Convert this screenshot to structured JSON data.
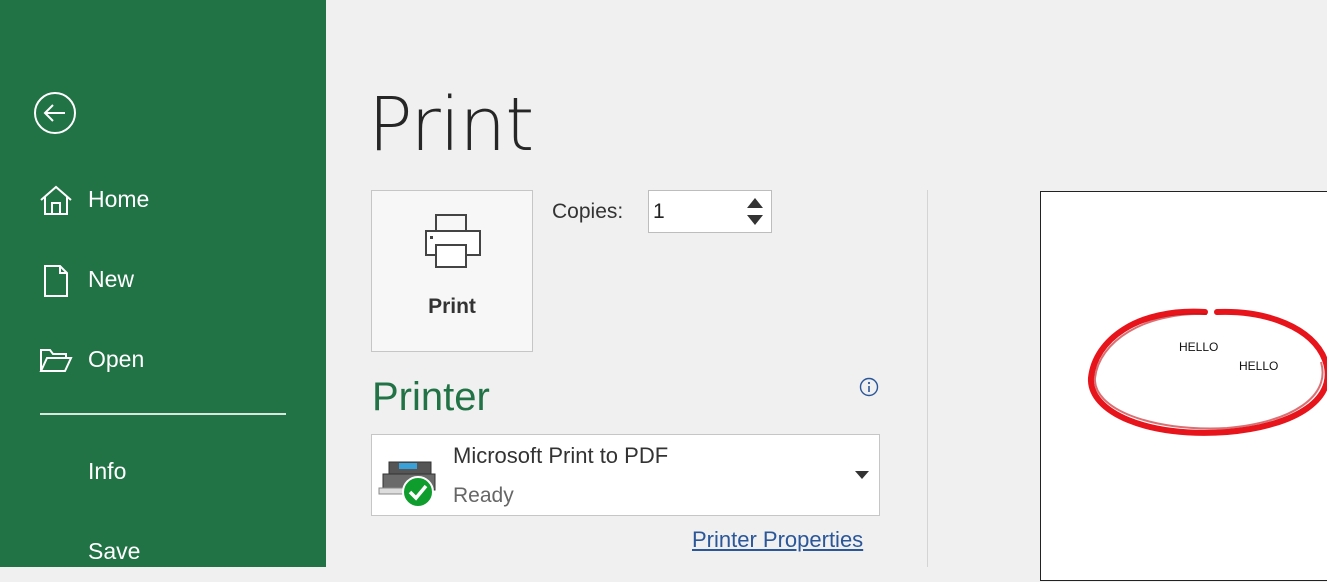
{
  "sidebar": {
    "back_icon": "back-arrow-icon",
    "items": [
      {
        "label": "Home",
        "icon": "home-icon"
      },
      {
        "label": "New",
        "icon": "new-document-icon"
      },
      {
        "label": "Open",
        "icon": "open-folder-icon"
      },
      {
        "label": "Info",
        "icon": ""
      },
      {
        "label": "Save",
        "icon": ""
      }
    ],
    "background": "#217346"
  },
  "main": {
    "title": "Print",
    "print_button_label": "Print",
    "copies_label": "Copies:",
    "copies_value": "1",
    "printer_heading": "Printer",
    "printer": {
      "name": "Microsoft Print to PDF",
      "status": "Ready"
    },
    "printer_properties_link": "Printer Properties",
    "accent": "#217346",
    "link_color": "#2b579a"
  },
  "preview": {
    "texts": [
      "HELLO",
      "HELLO"
    ],
    "circle_color": "#e8141b"
  }
}
